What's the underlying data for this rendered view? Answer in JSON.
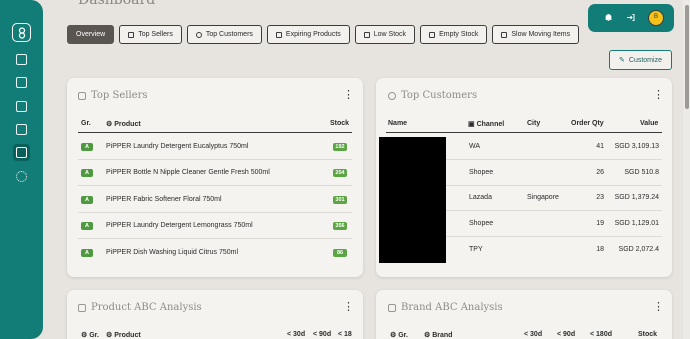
{
  "header": {
    "title": "Dashboard"
  },
  "tabs": [
    {
      "label": "Overview",
      "icon": "none"
    },
    {
      "label": "Top Sellers",
      "icon": "tag-icon"
    },
    {
      "label": "Top Customers",
      "icon": "smile-icon"
    },
    {
      "label": "Expiring Products",
      "icon": "hourglass-icon"
    },
    {
      "label": "Low Stock",
      "icon": "no-stock-icon"
    },
    {
      "label": "Empty Stock",
      "icon": "no-stock-icon"
    },
    {
      "label": "Slow Moving Items",
      "icon": "chart-icon"
    }
  ],
  "topbar": {
    "avatar_initial": "B"
  },
  "customize": {
    "label": "Customize"
  },
  "top_sellers": {
    "title": "Top Sellers",
    "headers": {
      "grade": "Gr.",
      "product": "Product",
      "stock": "Stock"
    },
    "rows": [
      {
        "grade": "A",
        "product": "PiPPER Laundry Detergent Eucalyptus 750ml",
        "stock": "192"
      },
      {
        "grade": "A",
        "product": "PiPPER Bottle N Nipple Cleaner Gentle Fresh 500ml",
        "stock": "204"
      },
      {
        "grade": "A",
        "product": "PiPPER Fabric Softener Floral 750ml",
        "stock": "301"
      },
      {
        "grade": "A",
        "product": "PiPPER Laundry Detergent Lemongrass 750ml",
        "stock": "356"
      },
      {
        "grade": "A",
        "product": "PiPPER Dish Washing Liquid Citrus 750ml",
        "stock": "86"
      }
    ]
  },
  "top_customers": {
    "title": "Top Customers",
    "headers": {
      "name": "Name",
      "channel": "Channel",
      "city": "City",
      "order_qty": "Order Qty",
      "value": "Value"
    },
    "rows": [
      {
        "channel": "WA",
        "city": "",
        "order_qty": "41",
        "value": "SGD 3,109.13"
      },
      {
        "channel": "Shopee",
        "city": "",
        "order_qty": "26",
        "value": "SGD 510.8"
      },
      {
        "channel": "Lazada",
        "city": "Singapore",
        "order_qty": "23",
        "value": "SGD 1,379.24"
      },
      {
        "channel": "Shopee",
        "city": "",
        "order_qty": "19",
        "value": "SGD 1,129.01"
      },
      {
        "channel": "TPY",
        "city": "",
        "order_qty": "18",
        "value": "SGD 2,072.4"
      }
    ]
  },
  "product_abc": {
    "title": "Product ABC Analysis",
    "headers": {
      "grade": "Gr.",
      "product": "Product",
      "c30": "< 30d",
      "c90": "< 90d",
      "c18": "< 18"
    }
  },
  "brand_abc": {
    "title": "Brand ABC Analysis",
    "headers": {
      "grade": "Gr.",
      "brand": "Brand",
      "c30": "< 30d",
      "c90": "< 90d",
      "c180": "< 180d",
      "stock": "Stock"
    }
  },
  "colors": {
    "accent": "#127d77",
    "grade_green": "#4f9a41",
    "background": "#e7e4e0"
  }
}
